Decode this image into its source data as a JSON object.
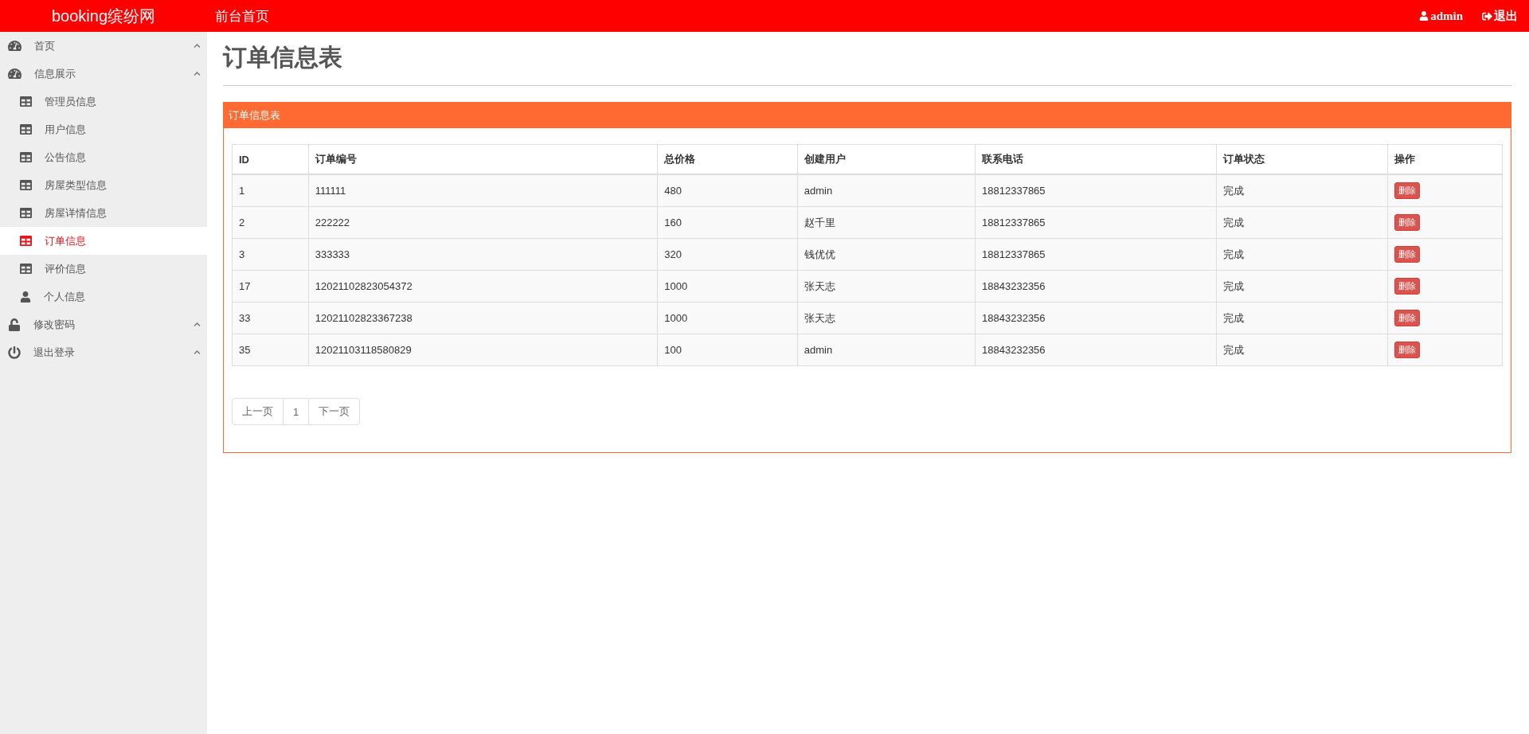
{
  "header": {
    "brand": "booking缤纷网",
    "nav_link": "前台首页",
    "user": "admin",
    "logout": "退出"
  },
  "sidebar": {
    "groups": [
      {
        "label": "首页",
        "kind": "dashboard"
      },
      {
        "label": "信息展示",
        "kind": "dashboard",
        "children": [
          {
            "label": "管理员信息",
            "kind": "table",
            "selected": false
          },
          {
            "label": "用户信息",
            "kind": "table",
            "selected": false
          },
          {
            "label": "公告信息",
            "kind": "table",
            "selected": false
          },
          {
            "label": "房屋类型信息",
            "kind": "table",
            "selected": false
          },
          {
            "label": "房屋详情信息",
            "kind": "table",
            "selected": false
          },
          {
            "label": "订单信息",
            "kind": "table",
            "selected": true
          },
          {
            "label": "评价信息",
            "kind": "table",
            "selected": false
          },
          {
            "label": "个人信息",
            "kind": "person",
            "selected": false
          }
        ]
      },
      {
        "label": "修改密码",
        "kind": "lock"
      },
      {
        "label": "退出登录",
        "kind": "power"
      }
    ]
  },
  "page_title": "订单信息表",
  "panel": {
    "title": "订单信息表",
    "table": {
      "columns": [
        "ID",
        "订单编号",
        "总价格",
        "创建用户",
        "联系电话",
        "订单状态",
        "操作"
      ],
      "rows": [
        {
          "cells": [
            "1",
            "111111",
            "480",
            "admin",
            "18812337865",
            "完成"
          ],
          "action": "删除"
        },
        {
          "cells": [
            "2",
            "222222",
            "160",
            "赵千里",
            "18812337865",
            "完成"
          ],
          "action": "删除"
        },
        {
          "cells": [
            "3",
            "333333",
            "320",
            "钱优优",
            "18812337865",
            "完成"
          ],
          "action": "删除"
        },
        {
          "cells": [
            "17",
            "12021102823054372",
            "1000",
            "张天志",
            "18843232356",
            "完成"
          ],
          "action": "删除"
        },
        {
          "cells": [
            "33",
            "12021102823367238",
            "1000",
            "张天志",
            "18843232356",
            "完成"
          ],
          "action": "删除"
        },
        {
          "cells": [
            "35",
            "12021103118580829",
            "100",
            "admin",
            "18843232356",
            "完成"
          ],
          "action": "删除"
        }
      ]
    },
    "pagination": [
      "上一页",
      "1",
      "下一页"
    ]
  }
}
